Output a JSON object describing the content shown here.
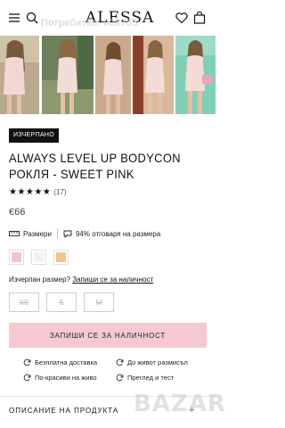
{
  "header": {
    "logo": "ALESSA",
    "watermark": "Потребител: 008765",
    "icons": [
      "menu-icon",
      "search-icon",
      "heart-icon",
      "bag-icon"
    ]
  },
  "gallery": {
    "images": [
      "product-photo-1",
      "product-photo-2",
      "product-photo-3",
      "product-photo-4",
      "product-photo-5"
    ]
  },
  "product": {
    "badge": "ИЗЧЕРПАНО",
    "title": "ALWAYS LEVEL UP BODYCON РОКЛЯ - SWEET PINK",
    "stars": "★★★★★",
    "reviews": "(17)",
    "price": "€66",
    "sizes_label": "Размери",
    "fit_text": "94% отговаря на размера",
    "swatch_colors": [
      "#f3c4c7",
      "#f2f2f2",
      "#f2c58c"
    ],
    "outline_text": "Изчерпан размер?",
    "outline_link": "Запиши се за наличност",
    "sizes": [
      "XS",
      "S",
      "M"
    ],
    "notify_button": "ЗАПИШИ СЕ ЗА НАЛИЧНОСТ"
  },
  "features": [
    {
      "label": "Безплатна доставка"
    },
    {
      "label": "До живот размисъл"
    },
    {
      "label": "По-красиви на живо"
    },
    {
      "label": "Преглед и тест"
    }
  ],
  "description": {
    "label": "ОПИСАНИЕ НА ПРОДУКТА",
    "icon": "plus-icon"
  },
  "overlay": {
    "bazar_watermark": "BAZAR"
  }
}
